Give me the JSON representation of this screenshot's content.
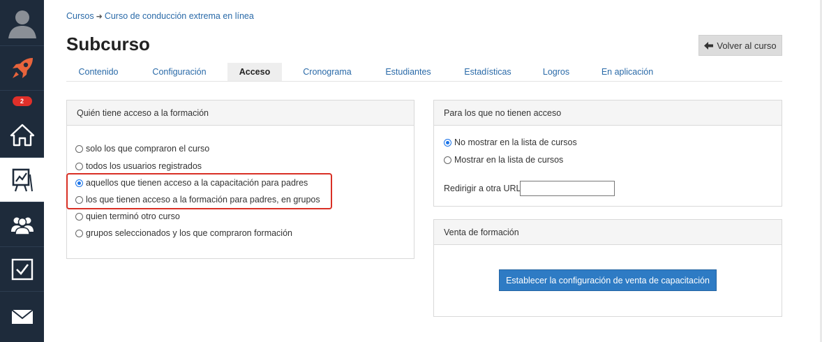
{
  "sidebar": {
    "badge_count": "2",
    "colors": {
      "bg": "#1e2b3b",
      "rocket": "#e8643c",
      "badge": "#e0302a"
    }
  },
  "breadcrumb": {
    "items": [
      "Cursos",
      "Curso de conducción extrema en línea"
    ],
    "separator": "➜"
  },
  "page": {
    "title": "Subcurso",
    "back_button": "Volver al curso"
  },
  "tabs": [
    {
      "label": "Contenido"
    },
    {
      "label": "Configuración"
    },
    {
      "label": "Acceso",
      "active": true
    },
    {
      "label": "Cronograma"
    },
    {
      "label": "Estudiantes"
    },
    {
      "label": "Estadísticas"
    },
    {
      "label": "Logros"
    },
    {
      "label": "En aplicación"
    }
  ],
  "access_panel": {
    "title": "Quién tiene acceso a la formación",
    "options": [
      {
        "label": "solo los que compraron el curso",
        "checked": false
      },
      {
        "label": "todos los usuarios registrados",
        "checked": false
      },
      {
        "label": "aquellos que tienen acceso a la capacitación para padres",
        "checked": true
      },
      {
        "label": "los que tienen acceso a la formación para padres, en grupos",
        "checked": false
      },
      {
        "label": "quien terminó otro curso",
        "checked": false
      },
      {
        "label": "grupos seleccionados y los que compraron formación",
        "checked": false
      }
    ]
  },
  "no_access_panel": {
    "title": "Para los que no tienen acceso",
    "options": [
      {
        "label": "No mostrar en la lista de cursos",
        "checked": true
      },
      {
        "label": "Mostrar en la lista de cursos",
        "checked": false
      }
    ],
    "redirect_label": "Redirigir a otra URL",
    "redirect_value": ""
  },
  "sale_panel": {
    "title": "Venta de formación",
    "button": "Establecer la configuración de venta de capacitación"
  }
}
